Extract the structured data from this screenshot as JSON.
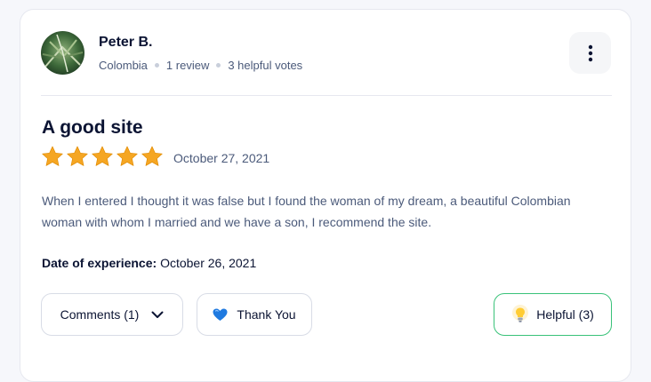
{
  "reviewer": {
    "name": "Peter B.",
    "country": "Colombia",
    "reviews": "1 review",
    "helpful_votes": "3 helpful votes",
    "avatar_icon": "avatar-photo"
  },
  "menu": {
    "icon": "more-vertical-icon"
  },
  "review": {
    "title": "A good site",
    "rating": 5,
    "rating_max": 5,
    "date": "October 27, 2021",
    "text": "When I entered I thought it was false but I found the woman of my dream, a beautiful Colombian woman with whom I married and we have a son, I recommend the site.",
    "experience_label": "Date of experience:",
    "experience_date": "October 26, 2021"
  },
  "actions": {
    "comments_label": "Comments (1)",
    "thanks_label": "Thank You",
    "helpful_label": "Helpful (3)"
  },
  "colors": {
    "star": "#f5a623",
    "helpful_border": "#39c279",
    "text_primary": "#0b1433",
    "text_secondary": "#4b5a7a"
  }
}
